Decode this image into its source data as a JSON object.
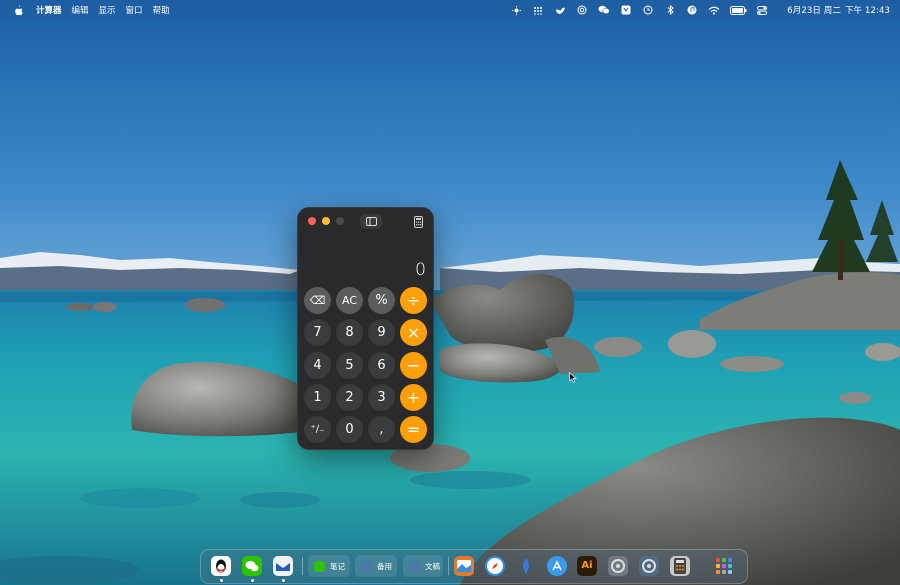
{
  "menubar": {
    "app_name": "计算器",
    "menus": [
      "编辑",
      "显示",
      "窗口",
      "帮助"
    ],
    "date": "6月23日 周二",
    "time": "下午 12:43",
    "tray_icons": [
      "brightness-icon",
      "grid-dots-icon",
      "bird-icon",
      "target-icon",
      "wechat-icon",
      "vpn-icon",
      "clock-icon",
      "bluetooth-icon",
      "music-icon",
      "wifi-icon",
      "battery-icon",
      "control-center-icon"
    ]
  },
  "calculator": {
    "display": "0",
    "keys": [
      {
        "label": "⌫",
        "kind": "fn",
        "name": "key-delete"
      },
      {
        "label": "AC",
        "kind": "fn",
        "name": "key-all-clear"
      },
      {
        "label": "%",
        "kind": "fn",
        "name": "key-percent"
      },
      {
        "label": "÷",
        "kind": "op",
        "name": "key-divide"
      },
      {
        "label": "7",
        "kind": "num",
        "name": "key-7"
      },
      {
        "label": "8",
        "kind": "num",
        "name": "key-8"
      },
      {
        "label": "9",
        "kind": "num",
        "name": "key-9"
      },
      {
        "label": "×",
        "kind": "op",
        "name": "key-multiply"
      },
      {
        "label": "4",
        "kind": "num",
        "name": "key-4"
      },
      {
        "label": "5",
        "kind": "num",
        "name": "key-5"
      },
      {
        "label": "6",
        "kind": "num",
        "name": "key-6"
      },
      {
        "label": "−",
        "kind": "op",
        "name": "key-subtract"
      },
      {
        "label": "1",
        "kind": "num",
        "name": "key-1"
      },
      {
        "label": "2",
        "kind": "num",
        "name": "key-2"
      },
      {
        "label": "3",
        "kind": "num",
        "name": "key-3"
      },
      {
        "label": "+",
        "kind": "op",
        "name": "key-add"
      },
      {
        "label": "⁺∕₋",
        "kind": "num",
        "name": "key-plus-minus"
      },
      {
        "label": "0",
        "kind": "num",
        "name": "key-0"
      },
      {
        "label": ",",
        "kind": "num",
        "name": "key-decimal"
      },
      {
        "label": "=",
        "kind": "op",
        "name": "key-equals"
      }
    ]
  },
  "dock": {
    "windows": [
      {
        "label": "笔记",
        "name": "dock-window-notes"
      },
      {
        "label": "备用",
        "name": "dock-window-backup"
      },
      {
        "label": "文稿",
        "name": "dock-window-documents"
      }
    ],
    "apps": [
      {
        "name": "qq-icon",
        "color": "#ffffff"
      },
      {
        "name": "wechat-icon",
        "color": "#2dc100"
      },
      {
        "name": "mail-icon",
        "color": "#f2f2f2"
      },
      {
        "name": "preview-icon",
        "color": "#e07a2f"
      },
      {
        "name": "safari-icon",
        "color": "#2f8ee0"
      },
      {
        "name": "testflight-icon",
        "color": "#4a7fd4"
      },
      {
        "name": "app-store-icon",
        "color": "#3a9af0"
      },
      {
        "name": "illustrator-icon",
        "color": "#2b1c07"
      },
      {
        "name": "grey-app-icon",
        "color": "#6f7a83"
      },
      {
        "name": "quicktime-icon",
        "color": "#4f6b80"
      },
      {
        "name": "calculator-icon",
        "color": "#c8c8c8"
      },
      {
        "name": "launchpad-icon",
        "color": "#3a4a5a"
      }
    ]
  }
}
